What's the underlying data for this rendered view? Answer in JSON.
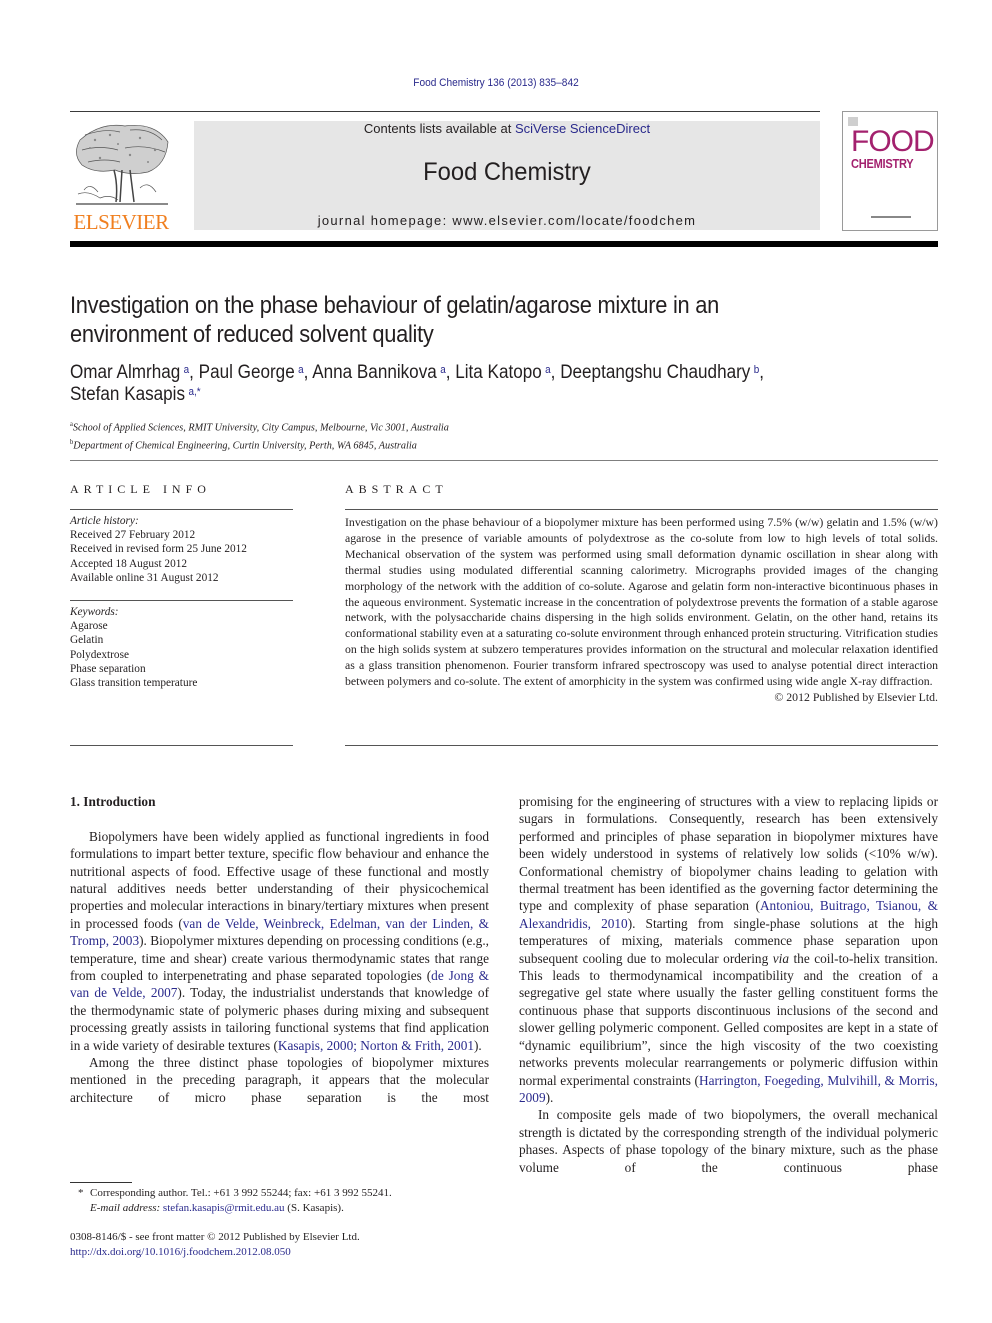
{
  "header": {
    "journal_ref": "Food Chemistry 136 (2013) 835–842",
    "contents_prefix": "Contents lists available at ",
    "contents_link": "SciVerse ScienceDirect",
    "journal_title": "Food Chemistry",
    "homepage_prefix": "journal homepage: ",
    "homepage_url": "www.elsevier.com/locate/foodchem",
    "publisher_logo_text": "ELSEVIER",
    "cover_title_line1": "FOOD",
    "cover_title_line2": "CHEMISTRY",
    "colors": {
      "elsevier_orange": "#f07f1f",
      "cover_magenta": "#a3216e",
      "link_blue": "#2a2a8c",
      "masthead_gray": "#e6e6e6"
    }
  },
  "article": {
    "title": "Investigation on the phase behaviour of gelatin/agarose mixture in an environment of reduced solvent quality",
    "authors": [
      {
        "name": "Omar Almrhag",
        "aff": "a"
      },
      {
        "name": "Paul George",
        "aff": "a"
      },
      {
        "name": "Anna Bannikova",
        "aff": "a"
      },
      {
        "name": "Lita Katopo",
        "aff": "a"
      },
      {
        "name": "Deeptangshu Chaudhary",
        "aff": "b"
      },
      {
        "name": "Stefan Kasapis",
        "aff": "a,*"
      }
    ],
    "affiliations": [
      {
        "key": "a",
        "text": "School of Applied Sciences, RMIT University, City Campus, Melbourne, Vic 3001, Australia"
      },
      {
        "key": "b",
        "text": "Department of Chemical Engineering, Curtin University, Perth, WA 6845, Australia"
      }
    ]
  },
  "article_info": {
    "heading": "ARTICLE INFO",
    "history_label": "Article history:",
    "history": [
      "Received 27 February 2012",
      "Received in revised form 25 June 2012",
      "Accepted 18 August 2012",
      "Available online 31 August 2012"
    ],
    "keywords_label": "Keywords:",
    "keywords": [
      "Agarose",
      "Gelatin",
      "Polydextrose",
      "Phase separation",
      "Glass transition temperature"
    ]
  },
  "abstract": {
    "heading": "ABSTRACT",
    "text": "Investigation on the phase behaviour of a biopolymer mixture has been performed using 7.5% (w/w) gel­atin and 1.5% (w/w) agarose in the presence of variable amounts of polydextrose as the co-solute from low to high levels of total solids. Mechanical observation of the system was performed using small defor­mation dynamic oscillation in shear along with thermal studies using modulated differential scanning calorimetry. Micrographs provided images of the changing morphology of the network with the addition of co-solute. Agarose and gelatin form non-interactive bicontinuous phases in the aqueous environment. Systematic increase in the concentration of polydextrose prevents the formation of a stable agarose net­work, with the polysaccharide chains dispersing in the high solids environment. Gelatin, on the other hand, retains its conformational stability even at a saturating co-solute environment through enhanced protein structuring. Vitrification studies on the high solids system at subzero temperatures provides information on the structural and molecular relaxation identified as a glass transition phenomenon. Fou­rier transform infrared spectroscopy was used to analyse potential direct interaction between polymers and co-solute. The extent of amorphicity in the system was confirmed using wide angle X-ray diffraction.",
    "copyright": "© 2012 Published by Elsevier Ltd."
  },
  "body": {
    "section_heading": "1. Introduction",
    "left": {
      "p1_a": "Biopolymers have been widely applied as functional ingredients in food formulations to impart better texture, specific flow behav­iour and enhance the nutritional aspects of food. Effective usage of these functional and mostly natural additives needs better under­standing of their physicochemical properties and molecular inter­actions in binary/tertiary mixtures when present in processed foods (",
      "cite1": "van de Velde, Weinbreck, Edelman, van der Linden, & Tromp, 2003",
      "p1_b": "). Biopolymer mixtures depending on processing conditions (e.g., temperature, time and shear) create various ther­modynamic states that range from coupled to interpenetrating and phase separated topologies (",
      "cite2": "de Jong & van de Velde, 2007",
      "p1_c": "). Today, the industrialist understands that knowledge of the thermody­namic state of polymeric phases during mixing and subsequent processing greatly assists in tailoring functional systems that find application in a wide variety of desirable textures (",
      "cite3": "Kasapis, 2000; Norton & Frith, 2001",
      "p1_d": ").",
      "p2": "Among the three distinct phase topologies of biopolymer mix­tures mentioned in the preceding paragraph, it appears that the molecular architecture of micro phase separation is the most"
    },
    "right": {
      "p1_a": "promising for the engineering of structures with a view to replac­ing lipids or sugars in formulations. Consequently, research has been extensively performed and principles of phase separation in biopolymer mixtures have been widely understood in systems of relatively low solids (<10% w/w). Conformational chemistry of bio­polymer chains leading to gelation with thermal treatment has been identified as the governing factor determining the type and complexity of phase separation (",
      "cite1": "Antoniou, Buitrago, Tsianou, & Alexandridis, 2010",
      "p1_b": "). Starting from single-phase solutions at the high temperatures of mixing, materials commence phase separa­tion upon subsequent cooling due to molecular ordering ",
      "via": "via",
      "p1_c": " the coil-to-helix transition. This leads to thermodynamical incompati­bility and the creation of a segregative gel state where usually the faster gelling constituent forms the continuous phase that supports discontinuous inclusions of the second and slower gelling poly­meric component. Gelled composites are kept in a state of “dynamic equilibrium”, since the high viscosity of the two coexis­ting networks prevents molecular rearrangements or polymeric diffusion within normal experimental constraints (",
      "cite2": "Harrington, Foegeding, Mulvihill, & Morris, 2009",
      "p1_d": ").",
      "p2": "In composite gels made of two biopolymers, the overall mechanical strength is dictated by the corresponding strength of the individual polymeric phases. Aspects of phase topology of the binary mixture, such as the phase volume of the continuous phase"
    }
  },
  "footnotes": {
    "star": "*",
    "corresponding": "Corresponding author. Tel.: +61 3 992 55244; fax: +61 3 992 55241.",
    "email_label": "E-mail address:",
    "email": "stefan.kasapis@rmit.edu.au",
    "email_suffix": " (S. Kasapis).",
    "front_matter": "0308-8146/$ - see front matter © 2012 Published by Elsevier Ltd.",
    "doi": "http://dx.doi.org/10.1016/j.foodchem.2012.08.050"
  }
}
